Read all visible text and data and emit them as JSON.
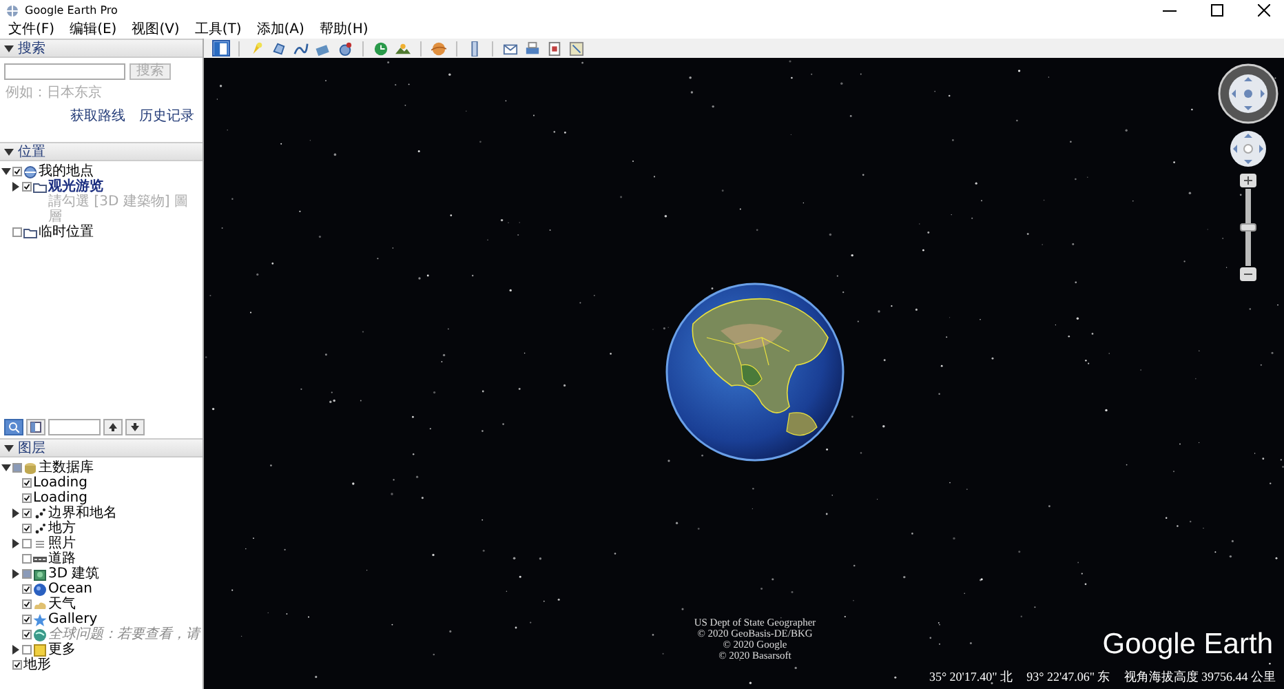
{
  "window": {
    "title": "Google Earth Pro"
  },
  "menu": [
    "文件(F)",
    "编辑(E)",
    "视图(V)",
    "工具(T)",
    "添加(A)",
    "帮助(H)"
  ],
  "toolbar": [
    {
      "kind": "sidebar",
      "selected": true
    },
    {
      "kind": "separator"
    },
    {
      "kind": "placemark",
      "selected": false
    },
    {
      "kind": "polygon",
      "selected": false
    },
    {
      "kind": "path",
      "selected": false
    },
    {
      "kind": "overlay",
      "selected": false
    },
    {
      "kind": "tour",
      "selected": false
    },
    {
      "kind": "separator"
    },
    {
      "kind": "history",
      "selected": false
    },
    {
      "kind": "sun",
      "selected": false
    },
    {
      "kind": "separator"
    },
    {
      "kind": "planet",
      "selected": false
    },
    {
      "kind": "separator"
    },
    {
      "kind": "ruler",
      "selected": false
    },
    {
      "kind": "separator"
    },
    {
      "kind": "email",
      "selected": false
    },
    {
      "kind": "print",
      "selected": false
    },
    {
      "kind": "save-image",
      "selected": false
    },
    {
      "kind": "map",
      "selected": false
    }
  ],
  "search": {
    "title": "搜索",
    "expanded": true,
    "example": "例如：日本东京",
    "button": {
      "label": "搜索",
      "disabled": true
    },
    "links": [
      "获取路线",
      "历史记录"
    ]
  },
  "places": {
    "title": "位置",
    "expanded": true,
    "items": [
      {
        "label": "我的地点",
        "kind": "globe",
        "checked": true,
        "partial": false,
        "dimmed": false,
        "selected": false,
        "expanded": true,
        "children": [
          {
            "label": "观光游览",
            "kind": "folder",
            "checked": true,
            "partial": false,
            "dimmed": false,
            "selected": true,
            "expanded": false,
            "note": "請勾選 [3D 建築物] 圖層"
          }
        ]
      },
      {
        "label": "临时位置",
        "kind": "folder",
        "checked": false,
        "partial": false,
        "dimmed": false,
        "selected": false
      }
    ]
  },
  "layers_toolbar": [
    {
      "kind": "search",
      "selected": true
    },
    {
      "kind": "panel",
      "selected": false
    }
  ],
  "layers": {
    "title": "图层",
    "expanded": true,
    "items": [
      {
        "label": "主数据库",
        "kind": "database",
        "checked": false,
        "partial": true,
        "dimmed": false,
        "expanded": true,
        "children": [
          {
            "label": "Loading",
            "kind": "none",
            "checked": true,
            "partial": false,
            "dimmed": false
          },
          {
            "label": "Loading",
            "kind": "none",
            "checked": true,
            "partial": false,
            "dimmed": false
          },
          {
            "label": "边界和地名",
            "kind": "borders",
            "checked": true,
            "partial": false,
            "dimmed": false,
            "expanded": false
          },
          {
            "label": "地方",
            "kind": "borders",
            "checked": true,
            "partial": false,
            "dimmed": false
          },
          {
            "label": "照片",
            "kind": "photo",
            "checked": false,
            "partial": false,
            "dimmed": false,
            "expanded": false
          },
          {
            "label": "道路",
            "kind": "road",
            "checked": false,
            "partial": false,
            "dimmed": false
          },
          {
            "label": "3D 建筑",
            "kind": "building",
            "checked": false,
            "partial": true,
            "dimmed": false,
            "expanded": false
          },
          {
            "label": "Ocean",
            "kind": "ocean",
            "checked": true,
            "partial": false,
            "dimmed": false
          },
          {
            "label": "天气",
            "kind": "weather",
            "checked": true,
            "partial": false,
            "dimmed": false
          },
          {
            "label": "Gallery",
            "kind": "gallery",
            "checked": true,
            "partial": false,
            "dimmed": false
          },
          {
            "label": "全球问题：若要查看，请",
            "kind": "issues",
            "checked": true,
            "partial": false,
            "dimmed": true
          },
          {
            "label": "更多",
            "kind": "note",
            "checked": false,
            "partial": false,
            "dimmed": false,
            "expanded": false
          }
        ]
      },
      {
        "label": "地形",
        "kind": "none",
        "checked": true,
        "partial": false,
        "dimmed": false
      }
    ]
  },
  "zoom_slider": {
    "level": 0.5
  },
  "map": {
    "attribution": [
      "US Dept of State Geographer",
      "© 2020 GeoBasis-DE/BKG",
      "© 2020 Google",
      "© 2020 Basarsoft"
    ],
    "logo": "Google Earth",
    "status": [
      "35° 20'17.40\" 北",
      "93° 22'47.06\" 东",
      "视角海拔高度 39756.44 公里"
    ]
  }
}
